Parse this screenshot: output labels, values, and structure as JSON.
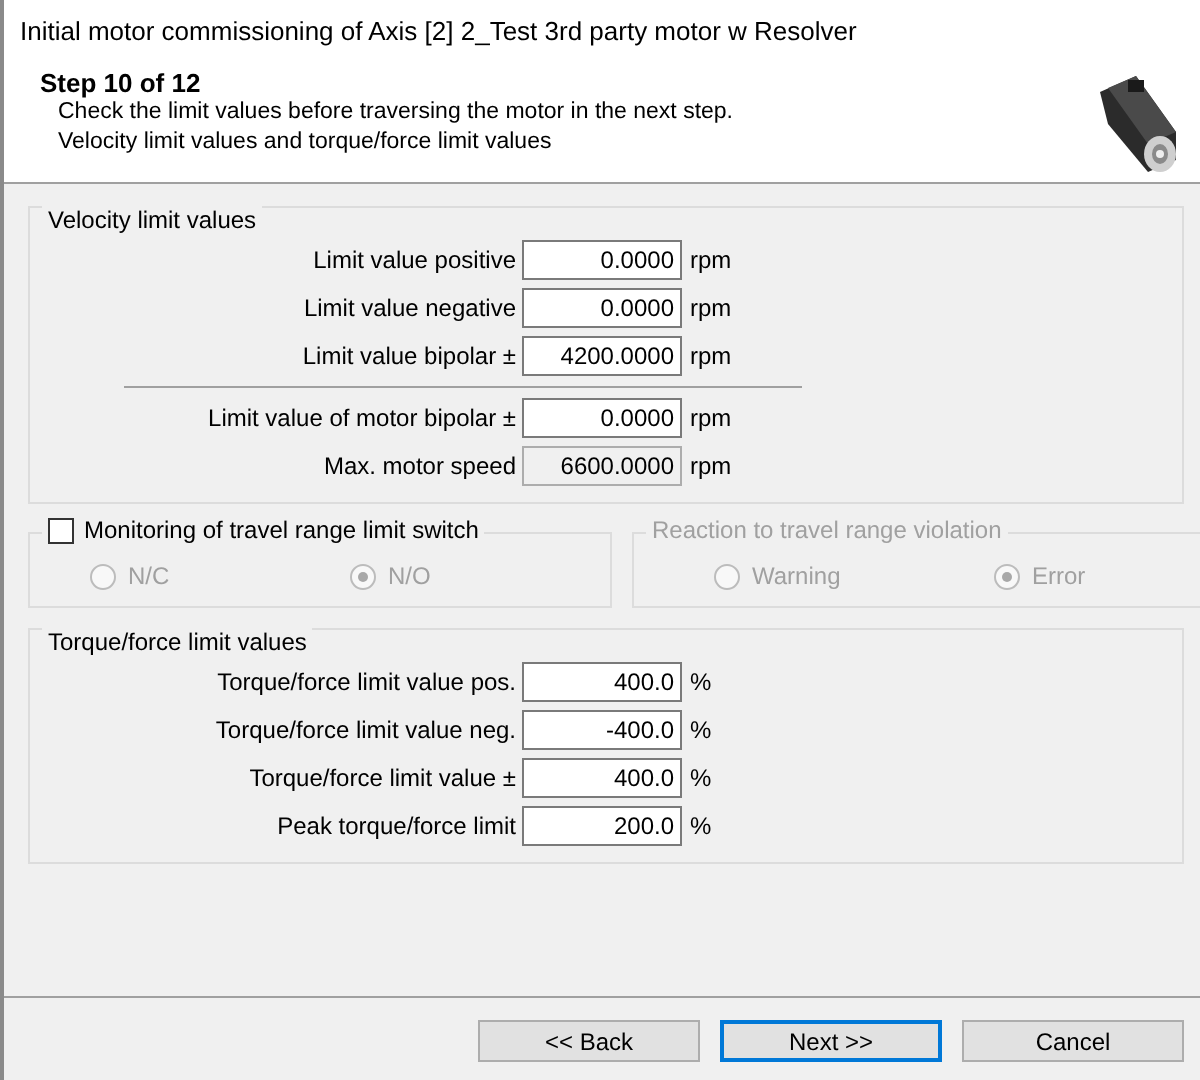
{
  "window": {
    "title": "Initial motor commissioning of Axis [2] 2_Test 3rd party motor w Resolver"
  },
  "header": {
    "step": "Step 10 of 12",
    "lines": [
      "Check the limit values before traversing the motor in the next step.",
      "Velocity limit values and torque/force limit values"
    ]
  },
  "velocity_group": {
    "title": "Velocity limit values",
    "rows": [
      {
        "label": "Limit value positive",
        "value": "0.0000",
        "unit": "rpm",
        "readonly": false
      },
      {
        "label": "Limit value negative",
        "value": "0.0000",
        "unit": "rpm",
        "readonly": false
      },
      {
        "label": "Limit value bipolar ±",
        "value": "4200.0000",
        "unit": "rpm",
        "readonly": false
      }
    ],
    "motor_rows": [
      {
        "label": "Limit value of motor bipolar ±",
        "value": "0.0000",
        "unit": "rpm",
        "readonly": false
      },
      {
        "label": "Max. motor speed",
        "value": "6600.0000",
        "unit": "rpm",
        "readonly": true
      }
    ]
  },
  "monitoring_group": {
    "title": "Monitoring of travel range limit switch",
    "checked": false,
    "options": [
      {
        "label": "N/C",
        "selected": false,
        "disabled": true
      },
      {
        "label": "N/O",
        "selected": true,
        "disabled": true
      }
    ]
  },
  "reaction_group": {
    "title": "Reaction to travel range violation",
    "disabled": true,
    "options": [
      {
        "label": "Warning",
        "selected": false,
        "disabled": true
      },
      {
        "label": "Error",
        "selected": true,
        "disabled": true
      }
    ]
  },
  "torque_group": {
    "title": "Torque/force limit values",
    "rows": [
      {
        "label": "Torque/force limit value pos.",
        "value": "400.0",
        "unit": "%",
        "readonly": false
      },
      {
        "label": "Torque/force limit value neg.",
        "value": "-400.0",
        "unit": "%",
        "readonly": false
      },
      {
        "label": "Torque/force limit value ±",
        "value": "400.0",
        "unit": "%",
        "readonly": false
      },
      {
        "label": "Peak torque/force limit",
        "value": "200.0",
        "unit": "%",
        "readonly": false
      }
    ]
  },
  "buttons": [
    {
      "label": "<< Back",
      "default": false
    },
    {
      "label": "Next >>",
      "default": true
    },
    {
      "label": "Cancel",
      "default": false
    }
  ]
}
